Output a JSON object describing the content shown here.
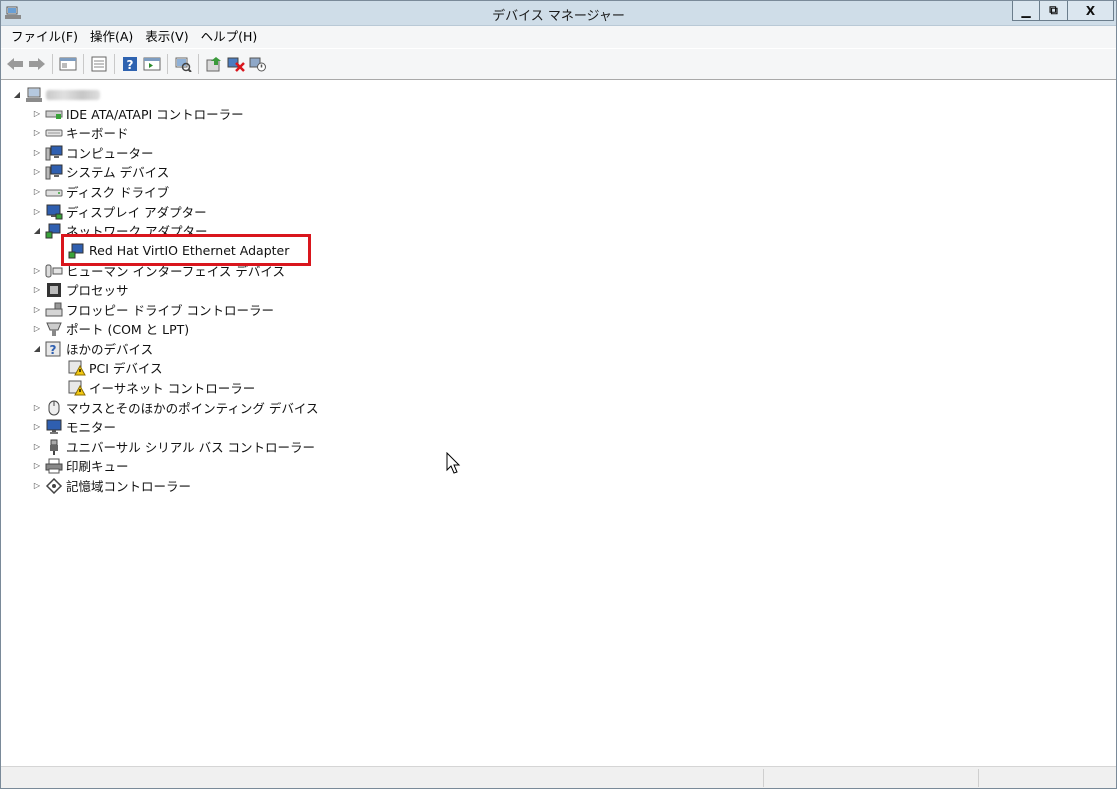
{
  "window": {
    "title": "デバイス マネージャー",
    "minimize_label": "▁",
    "restore_label": "⧉",
    "close_label": "X"
  },
  "menu": [
    "ファイル(F)",
    "操作(A)",
    "表示(V)",
    "ヘルプ(H)"
  ],
  "toolbar": [
    "back-icon",
    "forward-icon",
    "show-hide-console-tree-icon",
    "properties-icon",
    "help-icon",
    "view-icon",
    "scan-hardware-icon",
    "update-driver-icon",
    "uninstall-icon",
    "disable-icon"
  ],
  "tree": {
    "root": {
      "label": "",
      "expanded": true,
      "icon": "computer-root-icon"
    },
    "items": [
      {
        "label": "IDE ATA/ATAPI コントローラー",
        "expanded": false,
        "icon": "ide-controller-icon"
      },
      {
        "label": "キーボード",
        "expanded": false,
        "icon": "keyboard-icon"
      },
      {
        "label": "コンピューター",
        "expanded": false,
        "icon": "computer-icon"
      },
      {
        "label": "システム デバイス",
        "expanded": false,
        "icon": "system-device-icon"
      },
      {
        "label": "ディスク ドライブ",
        "expanded": false,
        "icon": "disk-drive-icon"
      },
      {
        "label": "ディスプレイ アダプター",
        "expanded": false,
        "icon": "display-adapter-icon"
      },
      {
        "label": "ネットワーク アダプター",
        "expanded": true,
        "icon": "network-adapter-icon",
        "children": [
          {
            "label": "Red Hat VirtIO Ethernet Adapter",
            "icon": "network-adapter-icon",
            "highlighted": true
          }
        ]
      },
      {
        "label": "ヒューマン インターフェイス デバイス",
        "expanded": false,
        "icon": "hid-icon"
      },
      {
        "label": "プロセッサ",
        "expanded": false,
        "icon": "processor-icon"
      },
      {
        "label": "フロッピー ドライブ コントローラー",
        "expanded": false,
        "icon": "floppy-controller-icon"
      },
      {
        "label": "ポート (COM と LPT)",
        "expanded": false,
        "icon": "port-icon"
      },
      {
        "label": "ほかのデバイス",
        "expanded": true,
        "icon": "other-device-icon",
        "children": [
          {
            "label": "PCI デバイス",
            "icon": "unknown-device-warning-icon"
          },
          {
            "label": "イーサネット コントローラー",
            "icon": "unknown-device-warning-icon"
          }
        ]
      },
      {
        "label": "マウスとそのほかのポインティング デバイス",
        "expanded": false,
        "icon": "mouse-icon"
      },
      {
        "label": "モニター",
        "expanded": false,
        "icon": "monitor-icon"
      },
      {
        "label": "ユニバーサル シリアル バス コントローラー",
        "expanded": false,
        "icon": "usb-icon"
      },
      {
        "label": "印刷キュー",
        "expanded": false,
        "icon": "printer-icon"
      },
      {
        "label": "記憶域コントローラー",
        "expanded": false,
        "icon": "storage-controller-icon"
      }
    ]
  },
  "colors": {
    "highlight_border": "#d9161d",
    "titlebar": "#cfdde8"
  }
}
